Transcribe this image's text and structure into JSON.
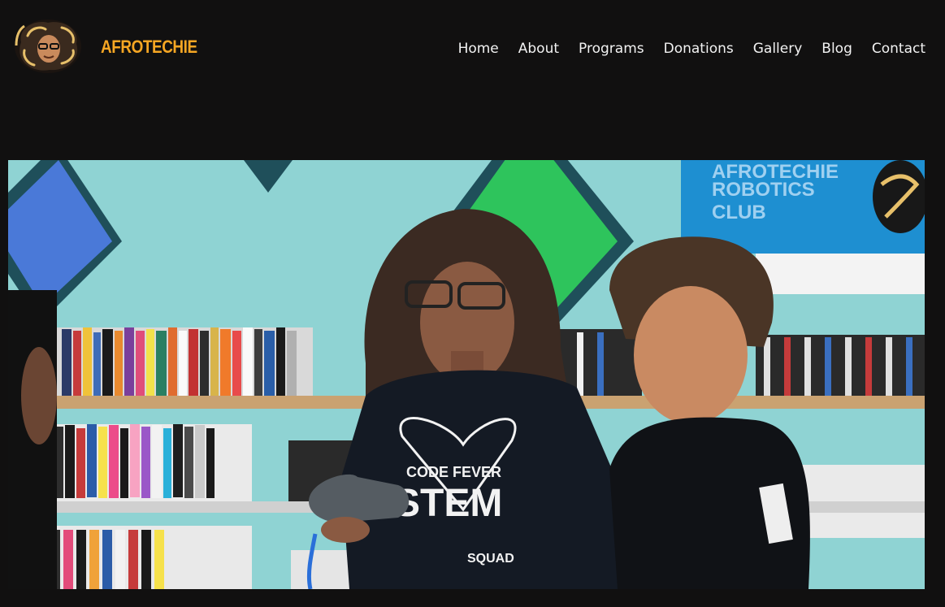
{
  "brand": {
    "name": "AFROTECHIE",
    "color": "#f6a623"
  },
  "nav": {
    "items": [
      {
        "label": "Home"
      },
      {
        "label": "About"
      },
      {
        "label": "Programs"
      },
      {
        "label": "Donations"
      },
      {
        "label": "Gallery"
      },
      {
        "label": "Blog"
      },
      {
        "label": "Contact"
      }
    ]
  },
  "hero": {
    "banner_text": [
      "AFROTECHIE",
      "ROBOTICS",
      "CLUB"
    ],
    "shirt_text": {
      "top": "CODE FEVER",
      "main": "STEM",
      "bottom": "SQUAD"
    }
  },
  "colors": {
    "background": "#111010",
    "nav_text": "#f2f2f2",
    "wall": "#8fd3d3",
    "banner": "#1e8fd1"
  }
}
